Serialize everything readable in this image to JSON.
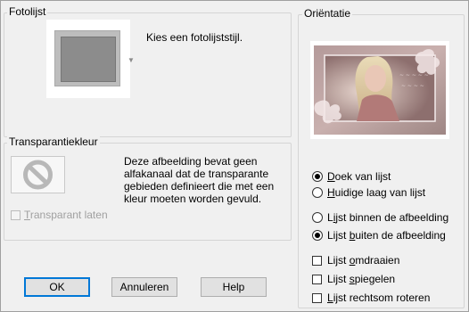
{
  "frame_group": {
    "legend": "Fotolijst",
    "hint": "Kies een fotolijststijl."
  },
  "transparency_group": {
    "legend": "Transparantiekleur",
    "message": [
      "Deze afbeelding bevat geen",
      "alfakanaal dat de transparante",
      "gebieden definieert die met een",
      "kleur moeten worden gevuld."
    ],
    "checkbox_prefix": "T",
    "checkbox_rest": "ransparant laten"
  },
  "orientation_group": {
    "legend": "Oriëntatie",
    "radio1": {
      "u": "D",
      "rest": "oek van lijst",
      "checked": true
    },
    "radio2": {
      "u": "H",
      "rest": "uidige laag van lijst",
      "checked": false
    },
    "radio3": {
      "pre": "L",
      "u": "i",
      "rest": "jst binnen de afbeelding",
      "checked": false
    },
    "radio4": {
      "pre": "Lijst ",
      "u": "b",
      "rest": "uiten de afbeelding",
      "checked": true
    },
    "check1": {
      "pre": "Lijst ",
      "u": "o",
      "rest": "mdraaien"
    },
    "check2": {
      "pre": "Lijst ",
      "u": "s",
      "rest": "piegelen"
    },
    "check3": {
      "pre": "",
      "u": "L",
      "rest": "ijst rechtsom roteren"
    }
  },
  "buttons": {
    "ok": "OK",
    "cancel": "Annuleren",
    "help": "Help"
  }
}
